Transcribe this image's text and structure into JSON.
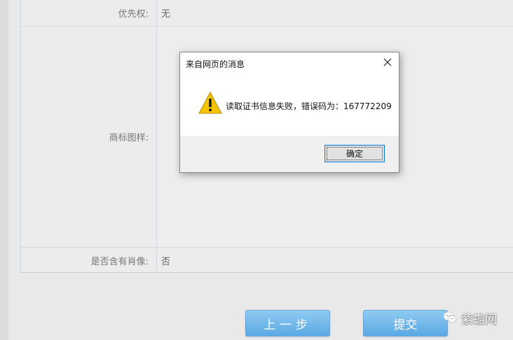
{
  "form": {
    "rows": [
      {
        "label": "优先权:",
        "value": "无"
      },
      {
        "label": "商标图样:",
        "value": ""
      },
      {
        "label": "是否含有肖像:",
        "value": "否"
      }
    ]
  },
  "buttons": {
    "prev_label": "上一步",
    "submit_label": "提交"
  },
  "watermark": {
    "text": "紫蟾网"
  },
  "dialog": {
    "title": "来自网页的消息",
    "message": "读取证书信息失败，错误码为：167772209",
    "ok_label": "确定"
  },
  "colors": {
    "button_blue": "#5aa9e3",
    "warning_yellow": "#f5c400",
    "focus_border": "#0078d7"
  },
  "icons": {
    "warning": "warning-icon",
    "close": "close-icon",
    "watermark": "wechat-icon"
  }
}
